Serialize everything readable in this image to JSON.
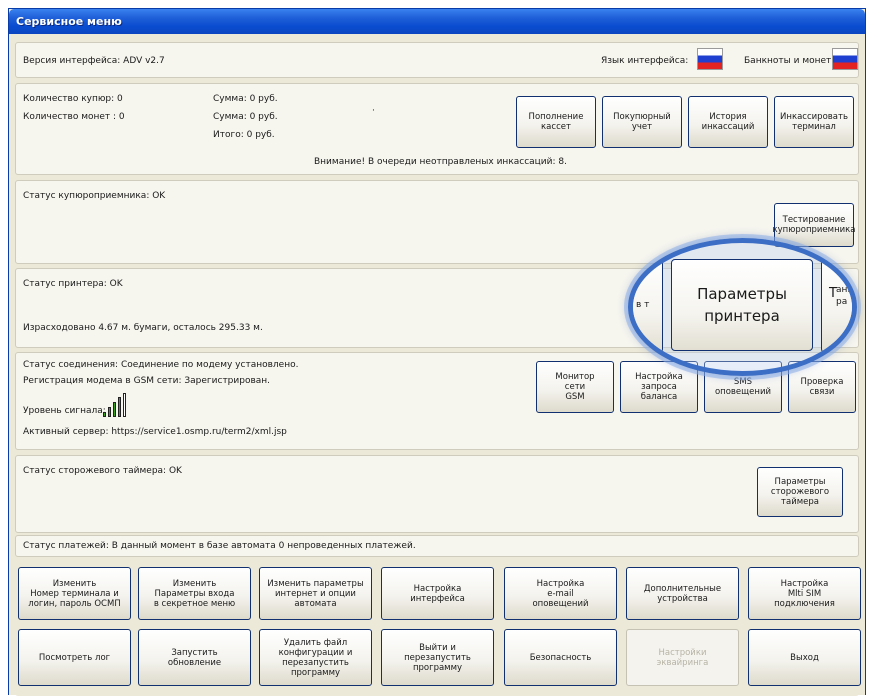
{
  "window": {
    "title": "Сервисное меню"
  },
  "header": {
    "version_label": "Версия интерфейса: ADV v2.7",
    "language_label": "Язык интерфейса:",
    "currency_label": "Банкноты и монеты:"
  },
  "cash": {
    "bills_count": "Количество купюр: 0",
    "coins_count": "Количество монет : 0",
    "sum1": "Сумма: 0 руб.",
    "sum2": "Сумма: 0 руб.",
    "total": "Итого: 0 руб.",
    "dot": "·",
    "warning": "Внимание! В очереди неотправленых инкассаций: 8.",
    "buttons": {
      "refill": "Пополнение\nкассет",
      "bills_account": "Покупюрный\nучет",
      "history": "История\nинкассаций",
      "collect": "Инкассировать\nтерминал"
    }
  },
  "validator": {
    "status": "Статус купюроприемника: OK",
    "test_button": "Тестирование\nкупюроприемника"
  },
  "printer": {
    "status": "Статус принтера: OK",
    "paper": "Израсходовано 4.67 м. бумаги, осталось 295.33 м.",
    "params_button": "Параметры\nпринтера",
    "left_edge_text": "в т",
    "right_edge_text": "Т",
    "right_edge_text2": "ание\nра"
  },
  "connection": {
    "status": "Статус соединения: Соединение по модему установлено.",
    "gsm_reg": "Регистрация модема в GSM сети: Зарегистрирован.",
    "signal_label": "Уровень сигнала:",
    "server": "Активный сервер: https://service1.osmp.ru/term2/xml.jsp",
    "buttons": {
      "gsm_monitor": "Монитор\nсети\nGSM",
      "balance_request": "Настройка\nзапроса\nбаланса",
      "sms": "SMS\nоповещений",
      "check": "Проверка\nсвязи"
    }
  },
  "watchdog": {
    "status": "Статус сторожевого таймера: OK",
    "params_button": "Параметры\nсторожевого\nтаймера"
  },
  "payments": {
    "status": "Статус платежей: В данный момент в базе автомата 0 непроведенных платежей."
  },
  "bottom_row1": [
    "Изменить\nНомер терминала и\nлогин, пароль ОСМП",
    "Изменить\nПараметры входа\nв секретное меню",
    "Изменить параметры\nинтернет и опции\nавтомата",
    "Настройка\nинтерфейса",
    "Настройка\ne-mail\nоповещений",
    "Дополнительные\nустройства",
    "Настройка\nMlti SIM\nподключения"
  ],
  "bottom_row2": [
    "Посмотреть лог",
    "Запустить\nобновление",
    "Удалить файл\nконфигурации и\nперезапустить\nпрограмму",
    "Выйти и\nперезапустить\nпрограмму",
    "Безопасность",
    "Настройки\nэквайринга",
    "Выход"
  ],
  "icons": {
    "language_flag": "russian-flag-icon",
    "currency_flag": "russian-flag-icon",
    "signal": "signal-strength-icon"
  },
  "signal_level": 0.8
}
